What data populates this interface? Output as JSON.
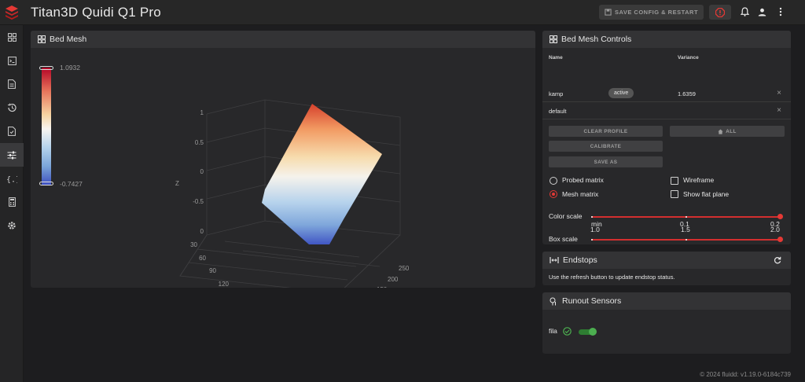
{
  "app": {
    "title": "Titan3D Quidi Q1 Pro"
  },
  "header": {
    "save_config_label": "SAVE CONFIG & RESTART",
    "icons": [
      "estop-icon",
      "bell-icon",
      "user-icon",
      "more-vert-icon"
    ]
  },
  "nav": {
    "items": [
      "dashboard-icon",
      "console-icon",
      "file-icon",
      "history-icon",
      "job-icon",
      "tune-icon",
      "code-icon",
      "calculator-icon",
      "gear-icon"
    ],
    "active_index": 5
  },
  "bed_mesh": {
    "title": "Bed Mesh",
    "scale_max": "1.0932",
    "scale_min": "-0.7427"
  },
  "mesh_plot": {
    "z_ticks": [
      "1",
      "0.5",
      "0",
      "-0.5",
      "0"
    ],
    "x_ticks": [
      "30",
      "60",
      "90",
      "120",
      "150",
      "180"
    ],
    "y_ticks": [
      "250",
      "200",
      "150",
      "100",
      "50"
    ],
    "x_label": "X",
    "y_label": "Y",
    "z_label": "Z"
  },
  "controls": {
    "title": "Bed Mesh Controls",
    "col_name": "Name",
    "col_variance": "Variance",
    "profiles": [
      {
        "name": "kamp",
        "badge": "active",
        "variance": "1.6359",
        "remove": "×"
      },
      {
        "name": "default",
        "badge": "",
        "variance": "",
        "remove": "×"
      }
    ],
    "buttons": {
      "clear_profile": "CLEAR PROFILE",
      "calibrate": "CALIBRATE",
      "save_as": "SAVE AS",
      "all": "ALL"
    },
    "options": {
      "probed_matrix": "Probed matrix",
      "mesh_matrix": "Mesh matrix",
      "wireframe": "Wireframe",
      "show_flat_plane": "Show flat plane",
      "selected_matrix": "mesh_matrix",
      "wireframe_checked": false,
      "flat_plane_checked": false
    },
    "color_scale": {
      "label": "Color scale",
      "ticks": [
        "min",
        "0.1",
        "0.2"
      ],
      "value_fraction": 1.0
    },
    "box_scale": {
      "label": "Box scale",
      "ticks": [
        "1.0",
        "1.5",
        "2.0"
      ],
      "value_fraction": 1.0
    }
  },
  "endstops": {
    "title": "Endstops",
    "message": "Use the refresh button to update endstop status."
  },
  "runout": {
    "title": "Runout Sensors",
    "sensor_name": "fila",
    "enabled": true
  },
  "footer": {
    "text": "© 2024 fluidd: v1.19.0-6184c739"
  },
  "colors": {
    "accent": "#e53935",
    "success": "#4caf50",
    "surface": "#28282a",
    "header": "#333335",
    "background": "#1d1d1f"
  }
}
